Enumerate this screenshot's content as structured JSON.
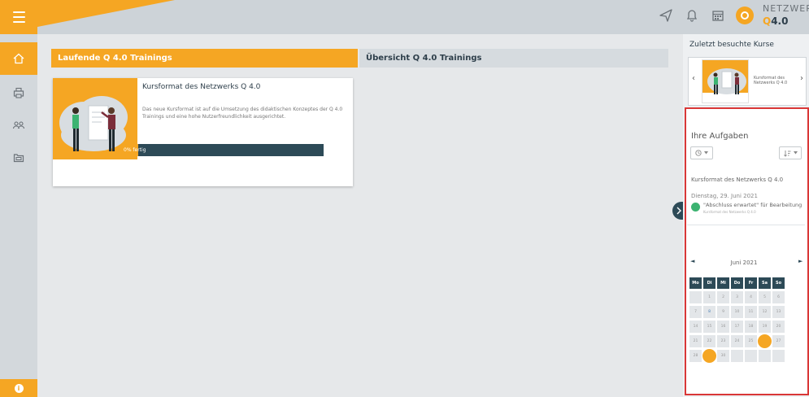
{
  "colors": {
    "accent": "#f5a623",
    "dark_teal": "#2d4a57",
    "highlight_frame": "#d93737",
    "event_status": "#3cb371"
  },
  "topbar": {
    "icons": [
      "paper-plane-icon",
      "bell-icon",
      "calendar-icon",
      "user-avatar-icon"
    ],
    "logo": {
      "line1": "NETZWERK",
      "line2_q": "Q",
      "line2": "4.0"
    }
  },
  "sidebar": {
    "items": [
      {
        "icon": "home-icon",
        "active": true
      },
      {
        "icon": "printer-icon",
        "active": false
      },
      {
        "icon": "users-icon",
        "active": false
      },
      {
        "icon": "folders-icon",
        "active": false
      }
    ],
    "info_icon": "i"
  },
  "main": {
    "tab_current": "Laufende Q 4.0 Trainings",
    "tab_overview": "Übersicht Q 4.0 Trainings",
    "course": {
      "title": "Kursformat des Netzwerks Q 4.0",
      "description": "Das neue Kursformat ist auf die Umsetzung des didaktischen Konzeptes der Q 4.0 Trainings und eine hohe Nutzerfreundlichkeit ausgerichtet.",
      "progress_label": "0% fertig",
      "progress_fraction": 0.08
    }
  },
  "right": {
    "recent_title": "Zuletzt besuchte Kurse",
    "recent_course_label": "Kursformat des Netzwerks Q 4.0",
    "tasks_title": "Ihre Aufgaben",
    "event": {
      "course": "Kursformat des Netzwerks Q 4.0",
      "date": "Dienstag, 29. Juni 2021",
      "text": "\"Abschluss erwartet\" für Bearbeitung",
      "sub": "Kursformat des Netzwerks Q 4.0"
    },
    "calendar": {
      "month": "Juni 2021",
      "weekdays": [
        "Mo",
        "Di",
        "Mi",
        "Do",
        "Fr",
        "Sa",
        "So"
      ],
      "weeks": [
        [
          "",
          "1",
          "2",
          "3",
          "4",
          "5",
          "6"
        ],
        [
          "7",
          "8",
          "9",
          "10",
          "11",
          "12",
          "13"
        ],
        [
          "14",
          "15",
          "16",
          "17",
          "18",
          "19",
          "20"
        ],
        [
          "21",
          "22",
          "23",
          "24",
          "25",
          "26",
          "27"
        ],
        [
          "28",
          "29",
          "30",
          "",
          "",
          "",
          ""
        ]
      ],
      "today": "26",
      "selected": "29",
      "event_day": "8"
    }
  }
}
